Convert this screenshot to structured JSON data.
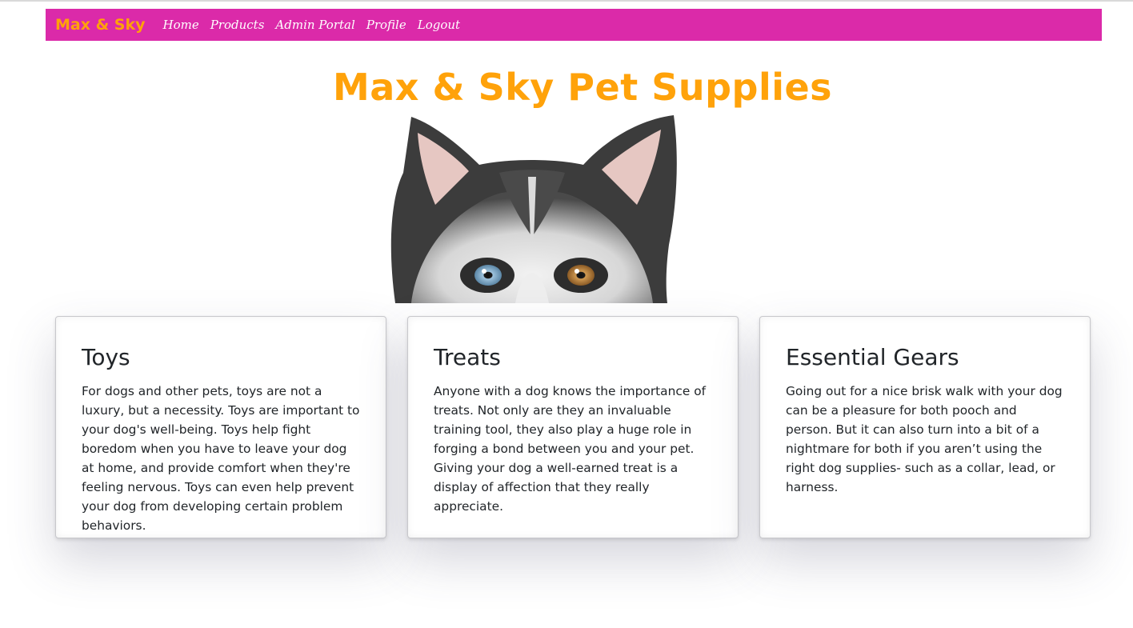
{
  "nav": {
    "brand": "Max & Sky",
    "links": [
      "Home",
      "Products",
      "Admin Portal",
      "Profile",
      "Logout"
    ],
    "background_color": "#db2aa9",
    "brand_color": "#ffa20a"
  },
  "hero": {
    "title": "Max & Sky Pet Supplies",
    "image": "husky-dog-peeking"
  },
  "cards": [
    {
      "title": "Toys",
      "text": "For dogs and other pets, toys are not a luxury, but a necessity. Toys are important to your dog's well-being. Toys help fight boredom when you have to leave your dog at home, and provide comfort when they're feeling nervous. Toys can even help prevent your dog from developing certain problem behaviors."
    },
    {
      "title": "Treats",
      "text": "Anyone with a dog knows the importance of treats. Not only are they an invaluable training tool, they also play a huge role in forging a bond between you and your pet. Giving your dog a well-earned treat is a display of affection that they really appreciate."
    },
    {
      "title": "Essential Gears",
      "text": "Going out for a nice brisk walk with your dog can be a pleasure for both pooch and person. But it can also turn into a bit of a nightmare for both if you aren’t using the right dog supplies- such as a collar, lead, or harness."
    }
  ]
}
